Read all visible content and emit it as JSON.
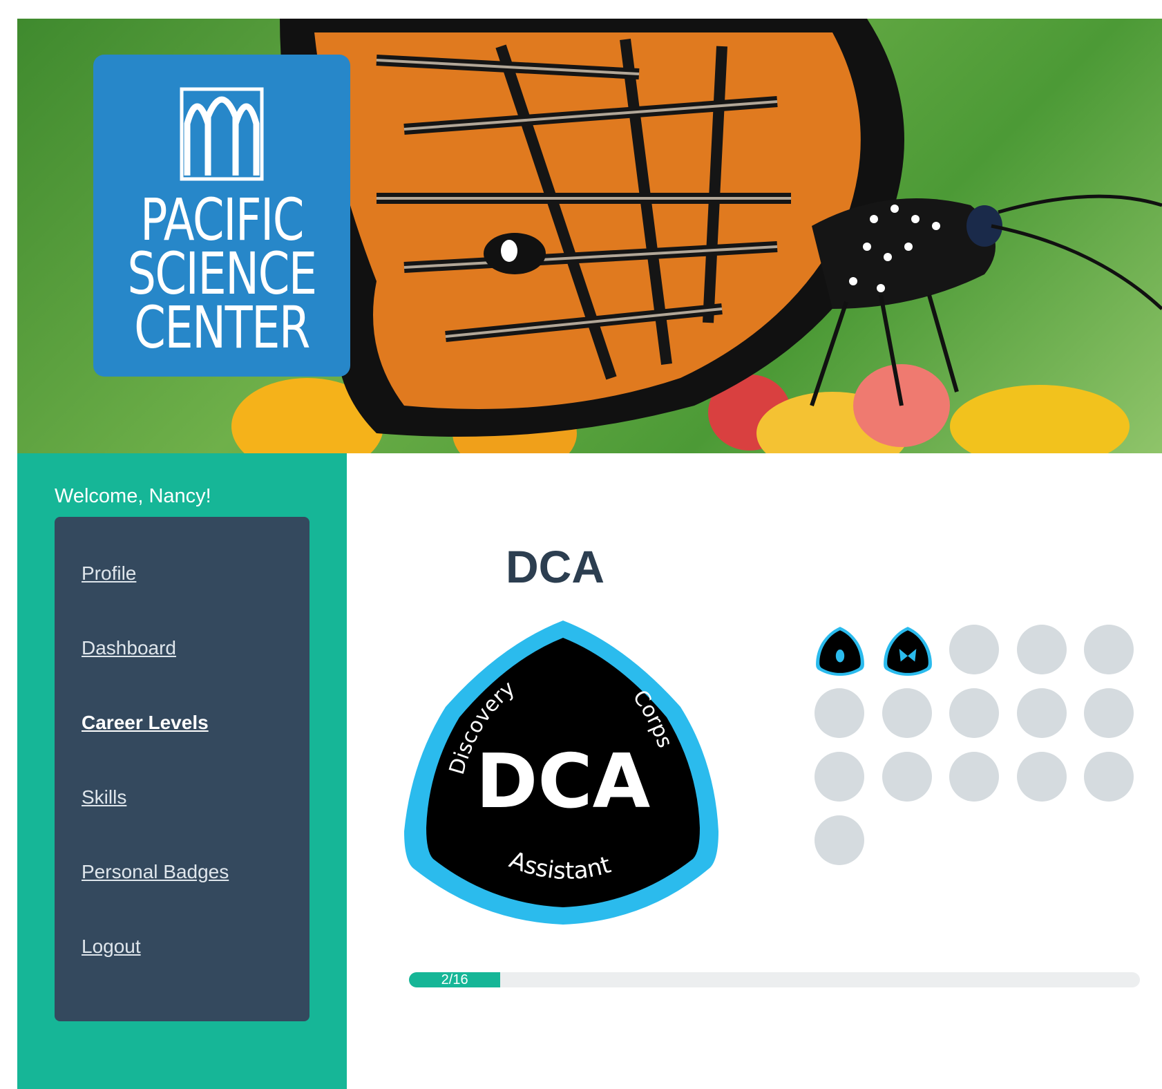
{
  "brand": {
    "logo_lines": [
      "PACIFIC",
      "SCIENCE",
      "CENTER"
    ]
  },
  "sidebar": {
    "welcome": "Welcome, Nancy!",
    "items": [
      {
        "label": "Profile",
        "active": false
      },
      {
        "label": "Dashboard",
        "active": false
      },
      {
        "label": "Career Levels",
        "active": true
      },
      {
        "label": "Skills",
        "active": false
      },
      {
        "label": "Personal Badges",
        "active": false
      },
      {
        "label": "Logout",
        "active": false
      }
    ]
  },
  "main": {
    "title": "DCA",
    "badge": {
      "center": "DCA",
      "arc_left": "Discovery",
      "arc_right": "Corps",
      "bottom": "Assistant",
      "rim_color": "#2bbbed",
      "fill_color": "#000000"
    },
    "skills": {
      "earned": 2,
      "total": 16,
      "earned_badges": [
        "beetle-badge-icon",
        "butterfly-badge-icon"
      ]
    },
    "progress": {
      "label": "2/16",
      "fraction": 0.125
    }
  },
  "colors": {
    "sidebar": "#16b697",
    "nav": "#34495e",
    "logo": "#2787c9",
    "title": "#2c3e50"
  }
}
